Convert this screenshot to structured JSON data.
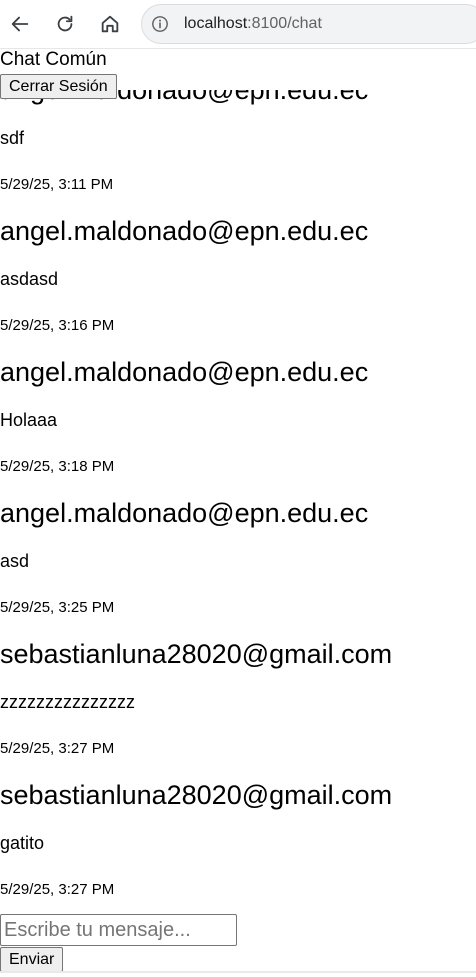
{
  "browser": {
    "url_host": "localhost",
    "url_rest": ":8100/chat"
  },
  "page": {
    "title": "Chat Común",
    "logout_label": "Cerrar Sesión"
  },
  "messages": [
    {
      "sender": "angel.maldonado@epn.edu.ec",
      "text": "sdf",
      "time": "5/29/25, 3:11 PM"
    },
    {
      "sender": "angel.maldonado@epn.edu.ec",
      "text": "asdasd",
      "time": "5/29/25, 3:16 PM"
    },
    {
      "sender": "angel.maldonado@epn.edu.ec",
      "text": "Holaaa",
      "time": "5/29/25, 3:18 PM"
    },
    {
      "sender": "angel.maldonado@epn.edu.ec",
      "text": "asd",
      "time": "5/29/25, 3:25 PM"
    },
    {
      "sender": "sebastianluna28020@gmail.com",
      "text": "zzzzzzzzzzzzzzz",
      "time": "5/29/25, 3:27 PM"
    },
    {
      "sender": "sebastianluna28020@gmail.com",
      "text": "gatito",
      "time": "5/29/25, 3:27 PM"
    }
  ],
  "composer": {
    "placeholder": "Escribe tu mensaje...",
    "value": "",
    "send_label": "Enviar"
  },
  "icons": {
    "back": "back-arrow-icon",
    "reload": "reload-icon",
    "home": "home-icon",
    "info": "info-icon"
  }
}
